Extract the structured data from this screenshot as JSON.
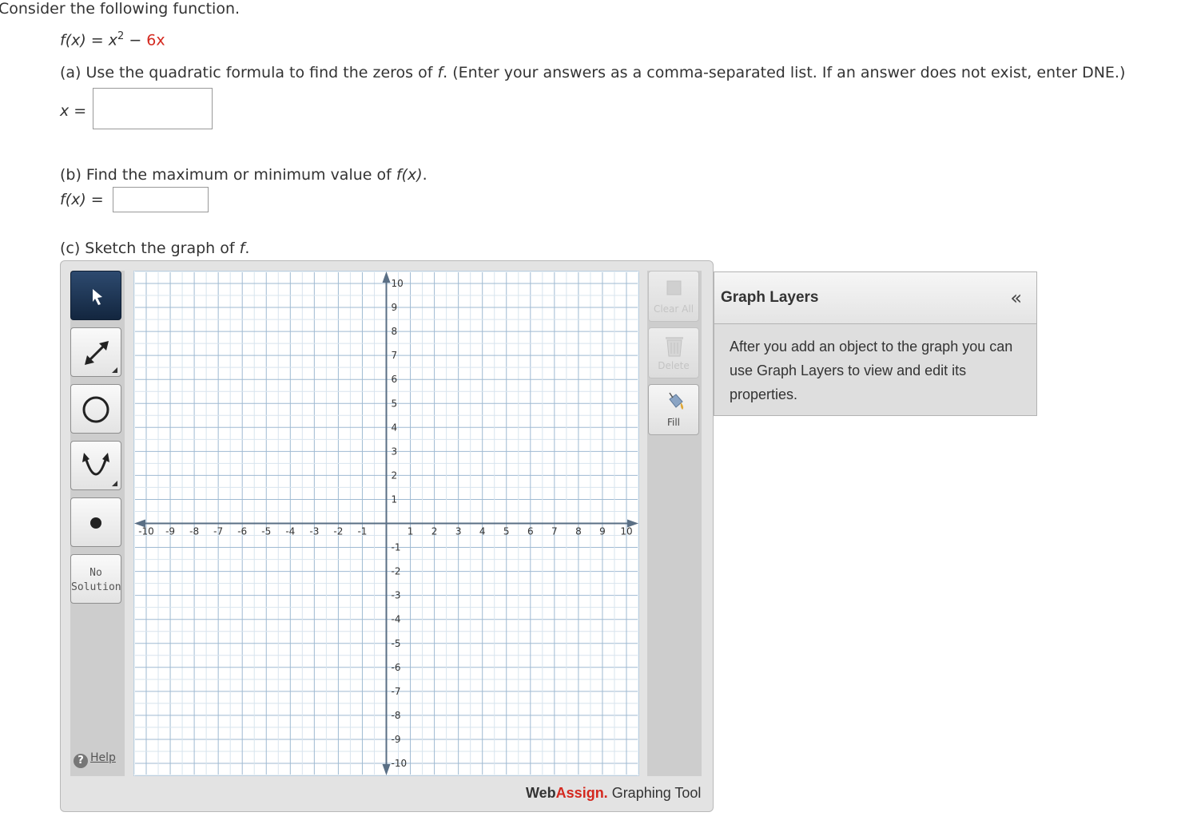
{
  "question": {
    "intro": "Consider the following function.",
    "function": {
      "lhs": "f(x) = x",
      "exponent": "2",
      "minus": " − ",
      "coef": "6x"
    },
    "part_a": {
      "text_start": "(a) Use the quadratic formula to find the zeros of ",
      "var": "f",
      "text_end": ". (Enter your answers as a comma-separated list. If an answer does not exist, enter DNE.)",
      "input_label": "x =",
      "input_value": ""
    },
    "part_b": {
      "text_start": "(b) Find the maximum or minimum value of ",
      "expr": "f(x)",
      "text_end": ".",
      "input_label": "f(x) =",
      "input_value": ""
    },
    "part_c": {
      "text_start": "(c) Sketch the graph of ",
      "var": "f",
      "text_end": "."
    }
  },
  "graph_tool": {
    "tools": [
      {
        "name": "pointer",
        "icon": "pointer-arrow-icon",
        "active": true
      },
      {
        "name": "line",
        "icon": "line-arrow-icon",
        "active": false
      },
      {
        "name": "circle",
        "icon": "circle-icon",
        "active": false
      },
      {
        "name": "parabola",
        "icon": "parabola-icon",
        "active": false
      },
      {
        "name": "point",
        "icon": "point-icon",
        "active": false
      }
    ],
    "no_solution_line1": "No",
    "no_solution_line2": "Solution",
    "help_label": "Help",
    "clear_all_label": "Clear All",
    "delete_label": "Delete",
    "fill_label": "Fill",
    "brand_web": "Web",
    "brand_assign": "Assign.",
    "brand_tool": " Graphing Tool",
    "axes": {
      "xmin": -10,
      "xmax": 10,
      "ymin": -10,
      "ymax": 10,
      "minor_step": 0.5,
      "major_step": 1
    },
    "colors": {
      "grid_minor": "#d8e4ee",
      "grid_major": "#9fbad2",
      "axis": "#5a6f85",
      "active_tool": "#1e3556"
    }
  },
  "layers_panel": {
    "title": "Graph Layers",
    "collapse_glyph": "«",
    "message": "After you add an object to the graph you can use Graph Layers to view and edit its properties."
  }
}
